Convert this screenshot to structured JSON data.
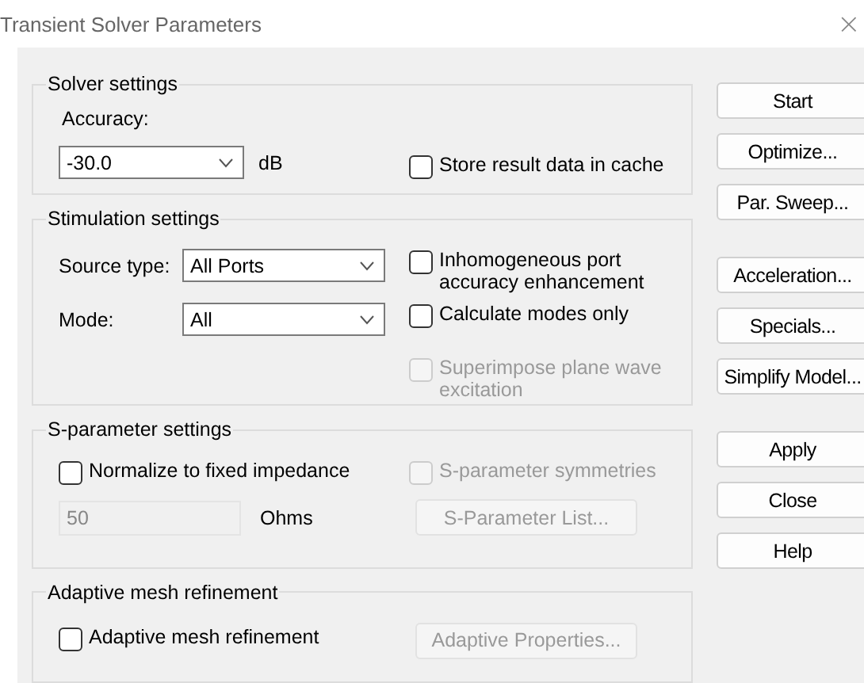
{
  "window": {
    "title": "Transient Solver Parameters",
    "close": "×"
  },
  "groups": [
    {
      "title": "Solver settings",
      "rows": [
        {
          "left": [
            {
              "kind": "label",
              "text": "Accuracy:"
            }
          ],
          "right": []
        },
        {
          "left": [
            {
              "kind": "combo",
              "value": "-30.0",
              "disabled": false
            },
            {
              "kind": "unit",
              "text": "dB"
            }
          ],
          "right": [
            {
              "kind": "checkbox",
              "label": "Store result data in cache",
              "checked": false,
              "disabled": false
            }
          ]
        }
      ]
    },
    {
      "title": "Stimulation settings",
      "rows": [
        {
          "left": [
            {
              "kind": "label",
              "text": "Source type:"
            },
            {
              "kind": "combo",
              "value": "All Ports",
              "disabled": false
            }
          ],
          "right": [
            {
              "kind": "checkbox",
              "label": "Inhomogeneous port accuracy enhancement",
              "checked": false,
              "disabled": false
            }
          ]
        },
        {
          "left": [
            {
              "kind": "label",
              "text": "Mode:"
            },
            {
              "kind": "combo",
              "value": "All",
              "disabled": false
            }
          ],
          "right": [
            {
              "kind": "checkbox",
              "label": "Calculate modes only",
              "checked": false,
              "disabled": false
            }
          ]
        },
        {
          "left": [],
          "right": [
            {
              "kind": "checkbox",
              "label": "Superimpose plane wave excitation",
              "checked": false,
              "disabled": true
            }
          ]
        }
      ]
    },
    {
      "title": "S-parameter settings",
      "rows": [
        {
          "left": [
            {
              "kind": "checkbox",
              "label": "Normalize to fixed impedance",
              "checked": false,
              "disabled": false
            }
          ],
          "right": [
            {
              "kind": "checkbox",
              "label": "S-parameter symmetries",
              "checked": false,
              "disabled": true
            }
          ]
        },
        {
          "left": [
            {
              "kind": "field",
              "value": "50",
              "disabled": true
            },
            {
              "kind": "unit",
              "text": "Ohms"
            }
          ],
          "right": [
            {
              "kind": "button",
              "label": "S-Parameter List...",
              "disabled": true
            }
          ]
        }
      ]
    },
    {
      "title": "Adaptive mesh refinement",
      "rows": [
        {
          "left": [
            {
              "kind": "checkbox",
              "label": "Adaptive mesh refinement",
              "checked": false,
              "disabled": false
            }
          ],
          "right": [
            {
              "kind": "button",
              "label": "Adaptive Properties...",
              "disabled": true
            }
          ]
        }
      ]
    }
  ],
  "button_groups": [
    [
      {
        "label": "Start",
        "disabled": false
      },
      {
        "label": "Optimize...",
        "disabled": false
      },
      {
        "label": "Par. Sweep...",
        "disabled": false
      }
    ],
    [
      {
        "label": "Acceleration...",
        "disabled": false
      },
      {
        "label": "Specials...",
        "disabled": false
      },
      {
        "label": "Simplify Model...",
        "disabled": false
      }
    ],
    [
      {
        "label": "Apply",
        "disabled": false
      },
      {
        "label": "Close",
        "disabled": false
      },
      {
        "label": "Help",
        "disabled": false
      }
    ]
  ]
}
